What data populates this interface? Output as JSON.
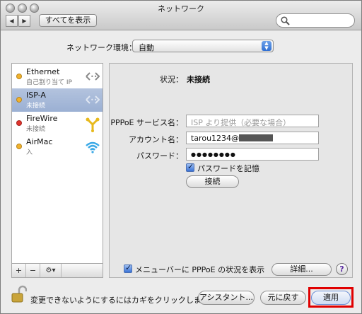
{
  "window": {
    "title": "ネットワーク"
  },
  "toolbar": {
    "back_glyph": "◀",
    "forward_glyph": "▶",
    "show_all_label": "すべてを表示",
    "search_placeholder": ""
  },
  "location": {
    "label": "ネットワーク環境：",
    "value": "自動"
  },
  "services": [
    {
      "name": "Ethernet",
      "status": "自己割り当て IP",
      "dot_color": "#f2b22c",
      "icon": "ethernet-arrows-icon"
    },
    {
      "name": "ISP-A",
      "status": "未接続",
      "dot_color": "#f2b22c",
      "icon": "ethernet-arrows-icon"
    },
    {
      "name": "FireWire",
      "status": "未接続",
      "dot_color": "#e0332c",
      "icon": "firewire-icon"
    },
    {
      "name": "AirMac",
      "status": "入",
      "dot_color": "#f2b22c",
      "icon": "wifi-icon"
    }
  ],
  "sidebar_footer": {
    "add": "+",
    "remove": "−",
    "action": "⚙▾"
  },
  "status": {
    "label": "状況：",
    "value": "未接続"
  },
  "fields": {
    "pppoe_service_label": "PPPoE サービス名：",
    "pppoe_service_placeholder": "ISP より提供（必要な場合）",
    "account_label": "アカウント名：",
    "account_value": "tarou1234@",
    "password_label": "パスワード：",
    "password_value": "●●●●●●●●"
  },
  "remember_password": {
    "label": "パスワードを記憶",
    "checked": true
  },
  "connect_button": "接続",
  "menu_bar_checkbox": {
    "label": "メニューバーに PPPoE の状況を表示",
    "checked": true
  },
  "advanced_button": "詳細...",
  "help_button": "?",
  "footer": {
    "lock_text": "変更できないようにするにはカギをクリックします。",
    "assistant_button": "アシスタント...",
    "revert_button": "元に戻す",
    "apply_button": "適用"
  },
  "colors": {
    "selection": "#9bb0d3",
    "highlight_box": "#e00000"
  }
}
